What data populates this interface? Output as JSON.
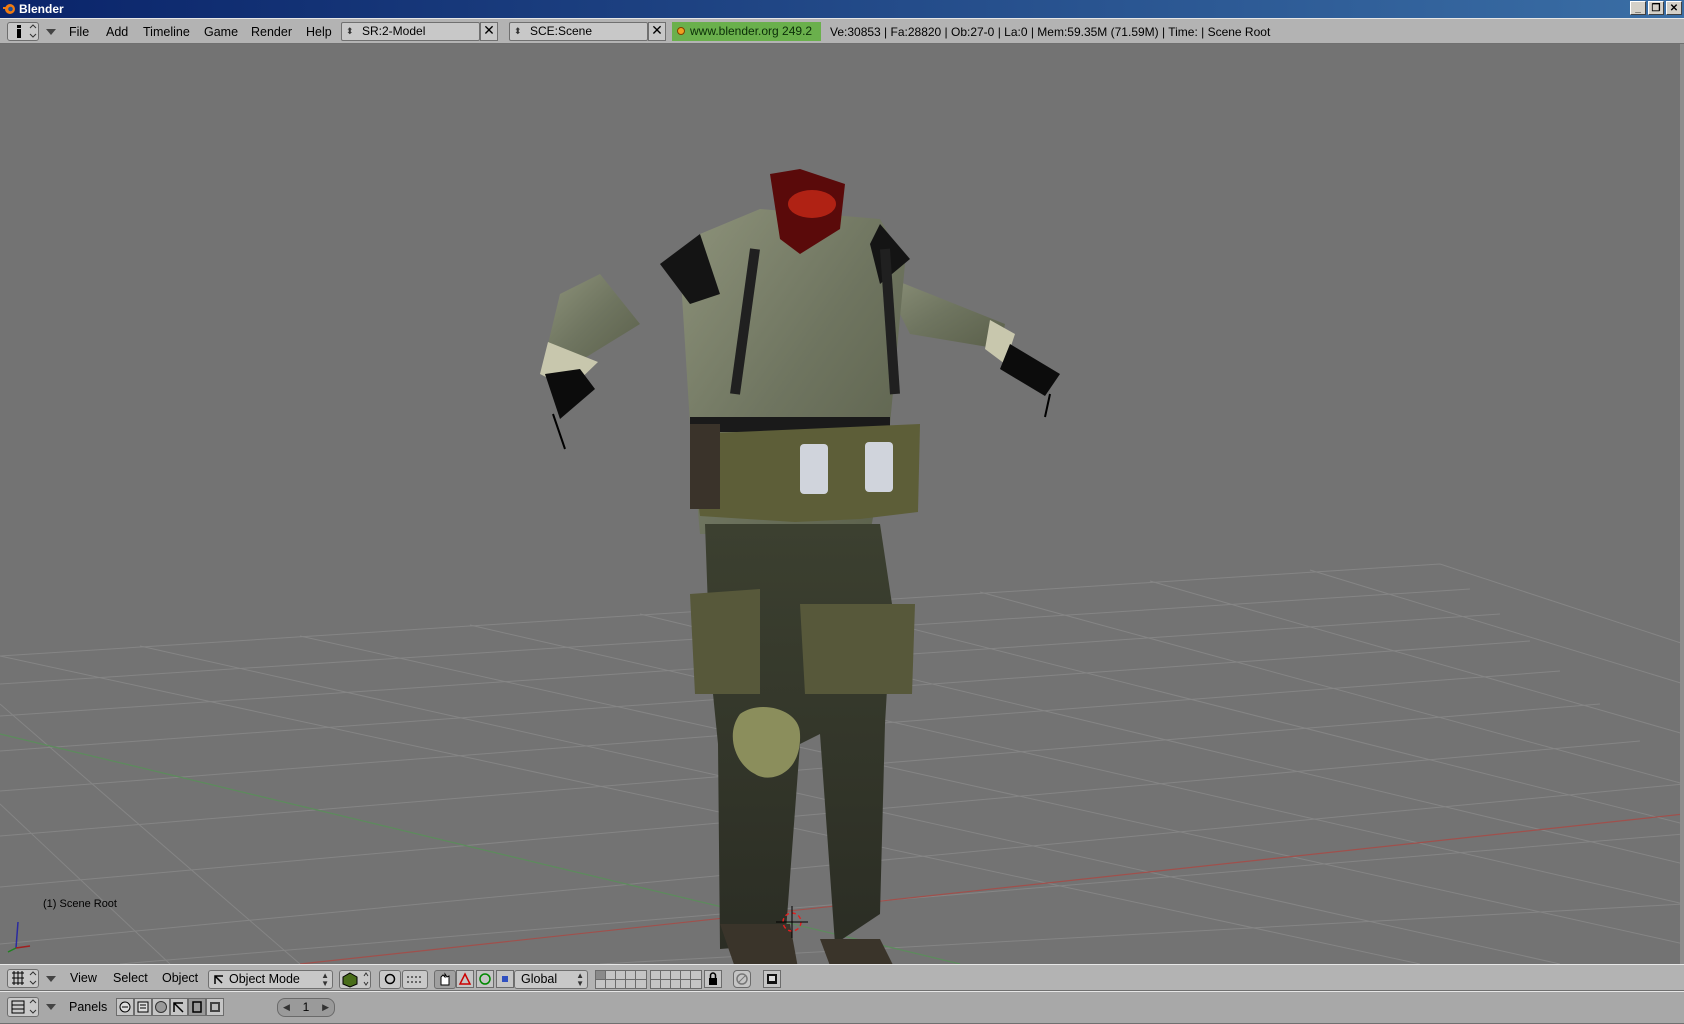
{
  "window": {
    "title": "Blender",
    "controls": [
      "_",
      "❐",
      "✕"
    ]
  },
  "topbar": {
    "menus": [
      "File",
      "Add",
      "Timeline",
      "Game",
      "Render",
      "Help"
    ],
    "screen_field": "SR:2-Model",
    "scene_field": "SCE:Scene",
    "url": "www.blender.org 249.2",
    "stats": "Ve:30853 | Fa:28820 | Ob:27-0 | La:0   | Mem:59.35M (71.59M)  | Time: | Scene Root"
  },
  "viewport": {
    "object_label": "(1) Scene Root",
    "colors": {
      "background": "#737373",
      "grid": "#858585",
      "x_axis": "#a0504c",
      "y_axis": "#5c8c5c"
    }
  },
  "view3d_header": {
    "menus": [
      "View",
      "Select",
      "Object"
    ],
    "mode": "Object Mode",
    "orientation": "Global"
  },
  "buttons_header": {
    "panels_label": "Panels",
    "frame": "1"
  }
}
